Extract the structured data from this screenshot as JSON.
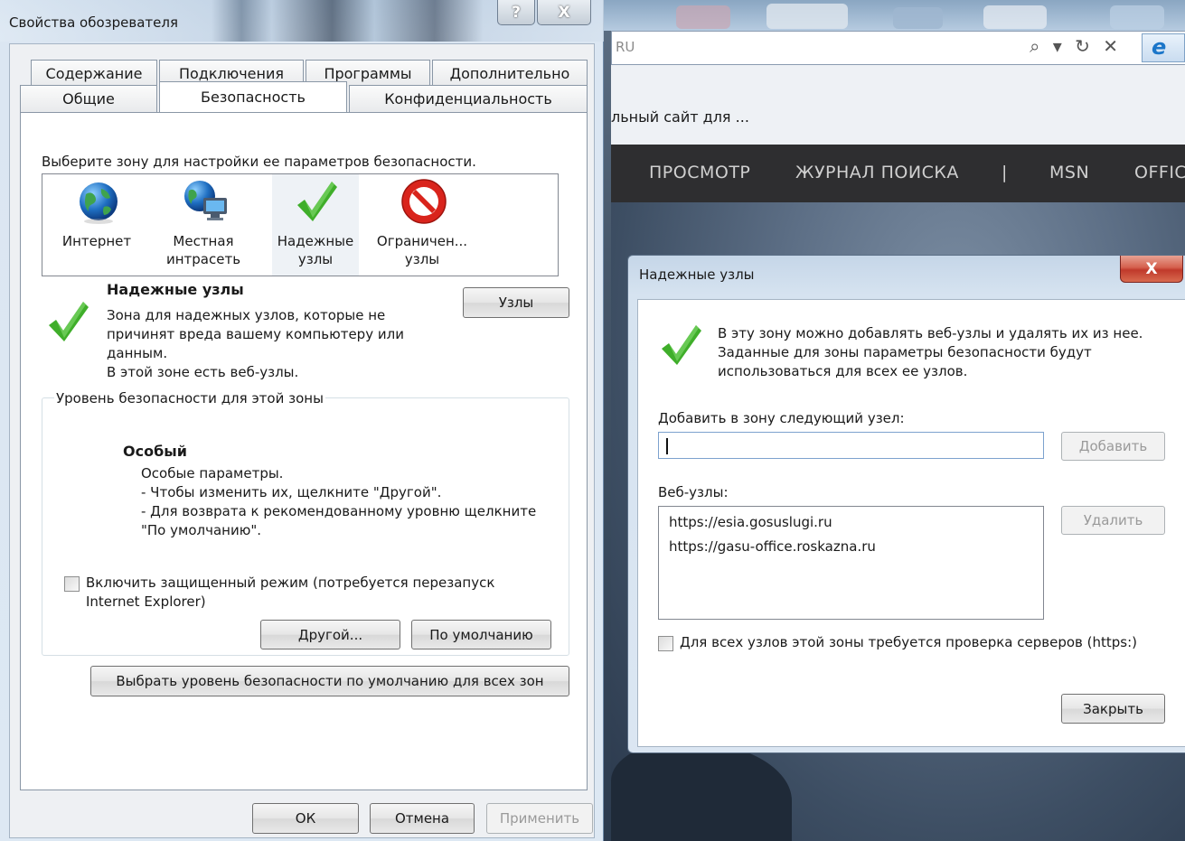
{
  "browser": {
    "address_text": "RU",
    "address_icons": "⌕ ▾ ↻ ✕",
    "ie_logo": "e",
    "tab_title": "льный сайт для ...",
    "nav": [
      "ПРОСМОТР",
      "ЖУРНАЛ ПОИСКА",
      "|",
      "MSN",
      "OFFIC"
    ]
  },
  "internet_options": {
    "title": "Свойства обозревателя",
    "help_button": "?",
    "close_button": "X",
    "tabs_row1": [
      "Содержание",
      "Подключения",
      "Программы",
      "Дополнительно"
    ],
    "tabs_row2": [
      "Общие",
      "Безопасность",
      "Конфиденциальность"
    ],
    "active_tab": "Безопасность",
    "zone_prompt": "Выберите зону для настройки ее параметров безопасности.",
    "zones": [
      {
        "label_line1": "Интернет",
        "label_line2": "",
        "icon": "globe-icon"
      },
      {
        "label_line1": "Местная",
        "label_line2": "интрасеть",
        "icon": "intranet-icon"
      },
      {
        "label_line1": "Надежные",
        "label_line2": "узлы",
        "icon": "checkmark-icon"
      },
      {
        "label_line1": "Ограничен...",
        "label_line2": "узлы",
        "icon": "restricted-icon"
      }
    ],
    "selected_zone": "Надежные узлы",
    "zone_title": "Надежные узлы",
    "zone_desc_lines": [
      "Зона для надежных узлов, которые не",
      "причинят вреда вашему компьютеру или",
      "данным.",
      "В этой зоне есть веб-узлы."
    ],
    "sites_button": "Узлы",
    "level_group_title": "Уровень безопасности для этой зоны",
    "level_name": "Особый",
    "level_desc_lines": [
      "Особые параметры.",
      "- Чтобы изменить их, щелкните \"Другой\".",
      "- Для возврата к рекомендованному уровню щелкните",
      "\"По умолчанию\"."
    ],
    "protected_mode_line1": "Включить защищенный режим (потребуется перезапуск",
    "protected_mode_line2": "Internet Explorer)",
    "protected_mode_checked": false,
    "custom_button": "Другой...",
    "default_button": "По умолчанию",
    "reset_all_button": "Выбрать уровень безопасности по умолчанию для всех зон",
    "ok_button": "ОК",
    "cancel_button": "Отмена",
    "apply_button": "Применить"
  },
  "trusted_sites": {
    "title": "Надежные узлы",
    "close_button": "X",
    "info_lines": [
      "В эту зону можно добавлять веб-узлы и удалять их из нее.",
      "Заданные для зоны параметры безопасности будут",
      "использоваться для всех ее узлов."
    ],
    "add_label": "Добавить в зону следующий узел:",
    "add_value": "",
    "add_button": "Добавить",
    "sites_label": "Веб-узлы:",
    "sites": [
      "https://esia.gosuslugi.ru",
      "https://gasu-office.roskazna.ru"
    ],
    "remove_button": "Удалить",
    "https_check_label": "Для всех узлов этой зоны требуется проверка серверов (https:)",
    "https_checked": false,
    "close_label": "Закрыть"
  },
  "colors": {
    "check_green": "#3fae2a",
    "restricted_red": "#d9241c",
    "globe_blue": "#1f6fc2",
    "navbar_bg": "#2e2e30"
  }
}
